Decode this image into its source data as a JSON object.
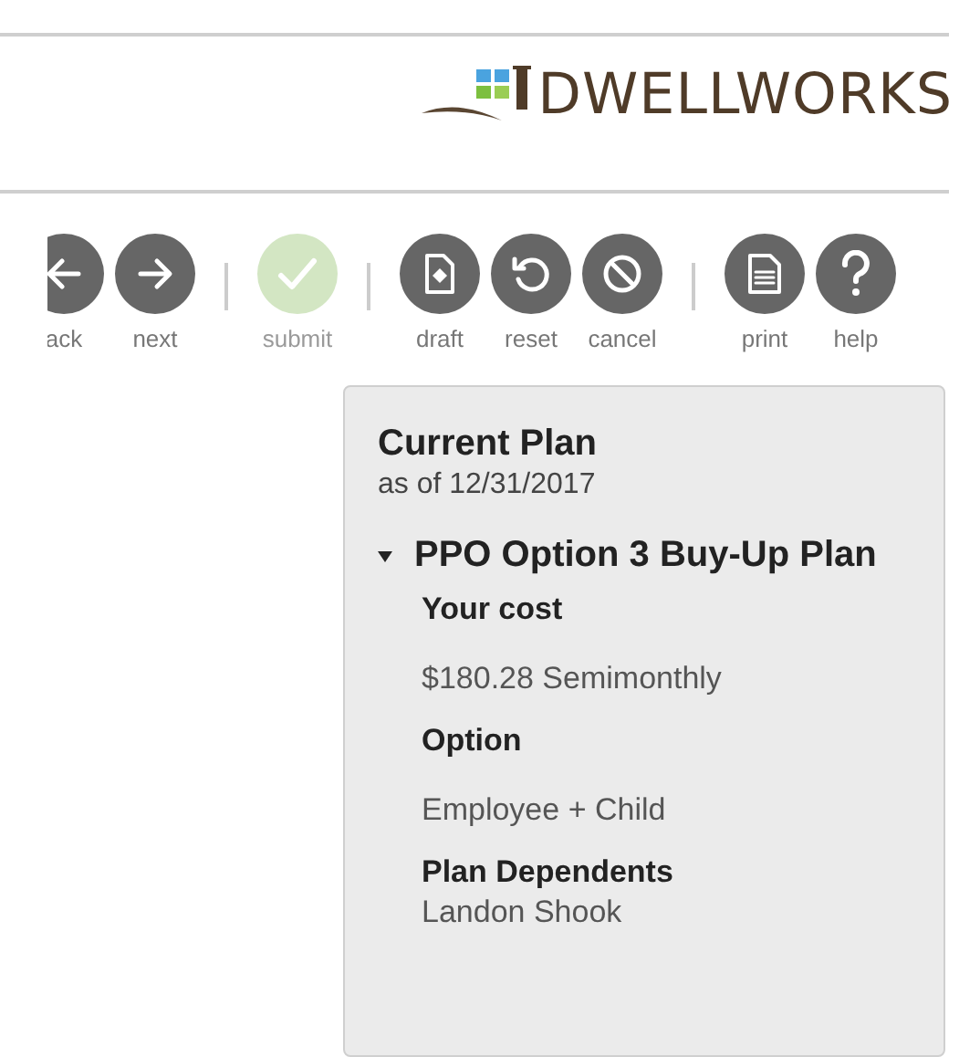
{
  "logo": {
    "text": "DWELLWORKS"
  },
  "toolbar": {
    "groups": [
      [
        {
          "kind": "back",
          "label": "ack",
          "disabled": false
        },
        {
          "kind": "next",
          "label": "next",
          "disabled": false
        }
      ],
      [
        {
          "kind": "submit",
          "label": "submit",
          "disabled": true
        }
      ],
      [
        {
          "kind": "draft",
          "label": "draft",
          "disabled": false
        },
        {
          "kind": "reset",
          "label": "reset",
          "disabled": false
        },
        {
          "kind": "cancel",
          "label": "cancel",
          "disabled": false
        }
      ],
      [
        {
          "kind": "print",
          "label": "print",
          "disabled": false
        },
        {
          "kind": "help",
          "label": "help",
          "disabled": false
        }
      ]
    ]
  },
  "card": {
    "title": "Current Plan",
    "subtitle": "as of 12/31/2017",
    "plan": {
      "name": "PPO Option 3 Buy-Up Plan",
      "expanded": true,
      "fields": [
        {
          "label": "Your cost",
          "value": "$180.28 Semimonthly"
        },
        {
          "label": "Option",
          "value": "Employee + Child"
        },
        {
          "label": "Plan Dependents",
          "value": "Landon Shook"
        }
      ]
    }
  }
}
